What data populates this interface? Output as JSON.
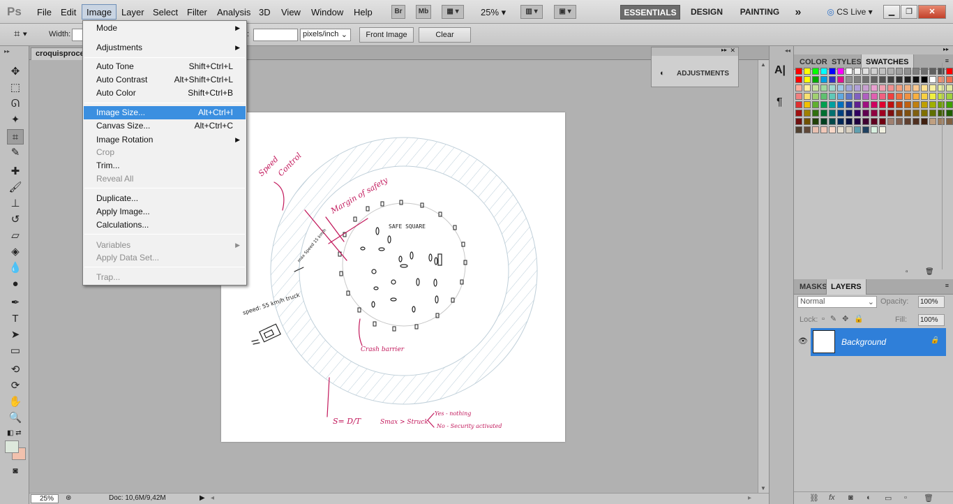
{
  "menubar": {
    "logo": "Ps",
    "items": [
      "File",
      "Edit",
      "Image",
      "Layer",
      "Select",
      "Filter",
      "Analysis",
      "3D",
      "View",
      "Window",
      "Help"
    ],
    "bridge": "Br",
    "minibridge": "Mb",
    "zoom": "25%",
    "workspaces": [
      "ESSENTIALS",
      "DESIGN",
      "PAINTING"
    ],
    "more": "»",
    "cslive": "CS Live"
  },
  "options": {
    "width_label": "Width:",
    "resolution_unit": "pixels/inch",
    "front_image": "Front Image",
    "clear": "Clear"
  },
  "document": {
    "tab_title": "croquisproce"
  },
  "image_menu": {
    "mode": "Mode",
    "adjustments": "Adjustments",
    "auto_tone": "Auto Tone",
    "auto_tone_sc": "Shift+Ctrl+L",
    "auto_contrast": "Auto Contrast",
    "auto_contrast_sc": "Alt+Shift+Ctrl+L",
    "auto_color": "Auto Color",
    "auto_color_sc": "Shift+Ctrl+B",
    "image_size": "Image Size...",
    "image_size_sc": "Alt+Ctrl+I",
    "canvas_size": "Canvas Size...",
    "canvas_size_sc": "Alt+Ctrl+C",
    "image_rotation": "Image Rotation",
    "crop": "Crop",
    "trim": "Trim...",
    "reveal_all": "Reveal All",
    "duplicate": "Duplicate...",
    "apply_image": "Apply Image...",
    "calculations": "Calculations...",
    "variables": "Variables",
    "apply_data_set": "Apply Data Set...",
    "trap": "Trap..."
  },
  "adjustments_panel": {
    "title": "ADJUSTMENTS"
  },
  "swatch_panel": {
    "tabs": [
      "COLOR",
      "STYLES",
      "SWATCHES"
    ],
    "active_tab": "SWATCHES"
  },
  "layers_panel": {
    "tabs": [
      "MASKS",
      "LAYERS"
    ],
    "blend_mode": "Normal",
    "opacity_label": "Opacity:",
    "opacity": "100%",
    "lock_label": "Lock:",
    "fill_label": "Fill:",
    "fill": "100%",
    "layer_name": "Background"
  },
  "statusbar": {
    "zoom": "25%",
    "doc": "Doc: 10,6M/9,42M"
  },
  "sketch": {
    "speed_control": "Speed",
    "control": "Control",
    "margin": "Margin of safety",
    "safe_square": "SAFE SQUARE",
    "max_speed": "max Speed 15 km/h",
    "truck": "speed: 55 km/h truck",
    "crash_barrier": "Crash barrier",
    "formula": "S= D/T",
    "smax": "Smax > Struck",
    "yes": "Yes - nothing",
    "no": "No - Security activated"
  },
  "colors": {
    "accent": "#3b8fe0",
    "sketch_pink": "#c2185b",
    "hatch": "#b9ccd8"
  }
}
